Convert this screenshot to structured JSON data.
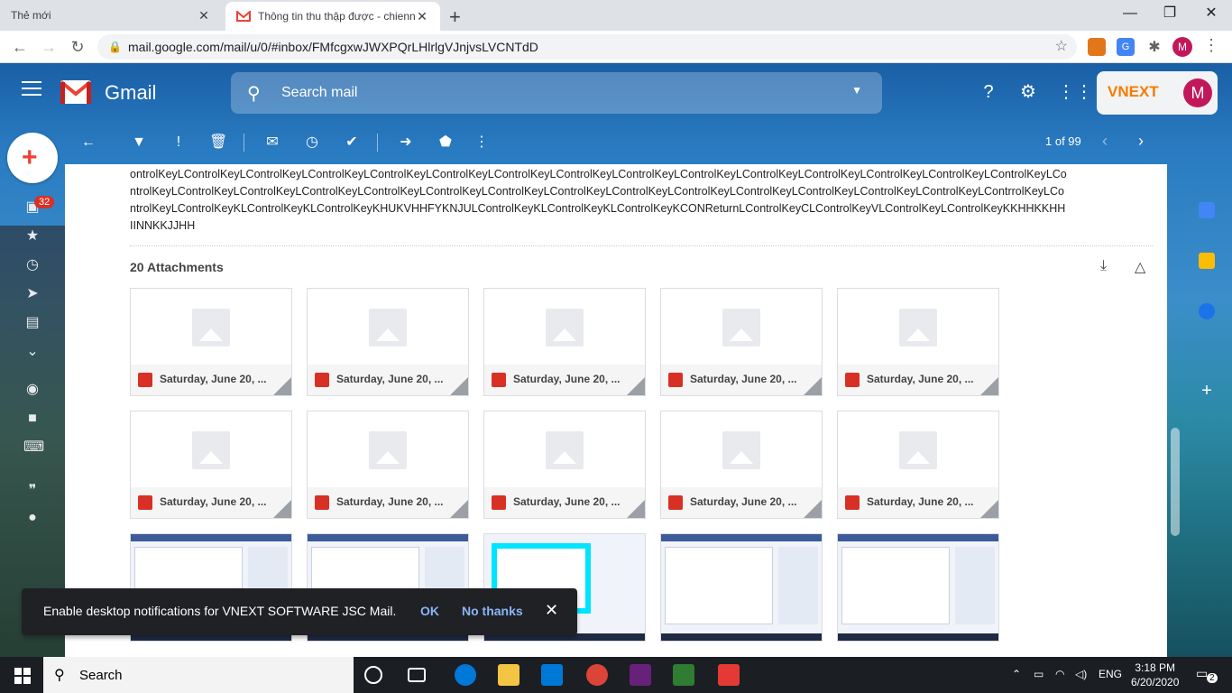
{
  "browser": {
    "tabs": [
      {
        "title": "Thẻ mới",
        "active": false
      },
      {
        "title": "Thông tin thu thập được - chienn",
        "active": true
      }
    ],
    "url": "mail.google.com/mail/u/0/#inbox/FMfcgxwJWXPQrLHlrlgVJnjvsLVCNTdD",
    "profile_initial": "M"
  },
  "gmail": {
    "logo_text": "Gmail",
    "search_placeholder": "Search mail",
    "account_brand": "VNEXT",
    "account_initial": "M",
    "unread_badge": "32",
    "pager": "1 of 99"
  },
  "message": {
    "body": "ontrolKeyLControlKeyLControlKeyLControlKeyLControlKeyLControlKeyLControlKeyLControlKeyLControlKeyLControlKeyLControlKeyLControlKeyLControlKeyLControlKeyLControlKeyLControlKeyLControlKeyLControlKeyLControlKeyLControlKeyLControlKeyLControlKeyLControlKeyLControlKeyLControlKeyLControlKeyLControlKeyLControlKeyLControlKeyLContrrolKeyLControlKeyLControlKeyKLControlKeyKLControlKeyKHUKVHHFYKNJULControlKeyKLControlKeyKLControlKeyKCONReturnLControlKeyCLControlKeyVLControlKeyLControlKeyKKHHKKHHIINNKKJJHH",
    "attachments_title": "20 Attachments",
    "attachments": [
      "Saturday, June 20, ...",
      "Saturday, June 20, ...",
      "Saturday, June 20, ...",
      "Saturday, June 20, ...",
      "Saturday, June 20, ...",
      "Saturday, June 20, ...",
      "Saturday, June 20, ...",
      "Saturday, June 20, ...",
      "Saturday, June 20, ...",
      "Saturday, June 20, ..."
    ]
  },
  "snackbar": {
    "message": "Enable desktop notifications for VNEXT SOFTWARE JSC Mail.",
    "ok": "OK",
    "no_thanks": "No thanks"
  },
  "taskbar": {
    "search_label": "Search",
    "language": "ENG",
    "time": "3:18 PM",
    "date": "6/20/2020",
    "notification_count": "2"
  },
  "colors": {
    "gmail_red": "#ea4335",
    "snackbar_bg": "#202124",
    "snackbar_action": "#8ab4f8"
  }
}
